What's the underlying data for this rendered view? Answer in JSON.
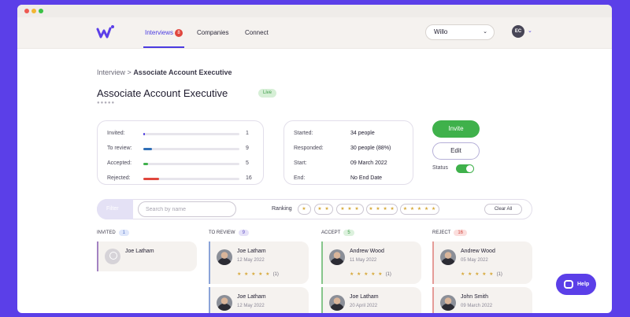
{
  "nav": {
    "links": [
      {
        "label": "Interviews",
        "badge": "8"
      },
      {
        "label": "Companies"
      },
      {
        "label": "Connect"
      }
    ],
    "company": "Willo",
    "user_initials": "EC"
  },
  "breadcrumb": {
    "parent": "Interview",
    "separator": ">",
    "current": "Associate Account Executive"
  },
  "job": {
    "title": "Associate Account Executive",
    "status": "Live",
    "subtitle": "●●●●●"
  },
  "stats": [
    {
      "label": "Invited:",
      "value": "1",
      "fraction": 0.02,
      "color": "#4b3be0"
    },
    {
      "label": "To review:",
      "value": "9",
      "fraction": 0.09,
      "color": "#2f6fb7"
    },
    {
      "label": "Accepted:",
      "value": "5",
      "fraction": 0.05,
      "color": "#3fb14b"
    },
    {
      "label": "Rejected:",
      "value": "16",
      "fraction": 0.16,
      "color": "#e0463d"
    }
  ],
  "info": [
    {
      "label": "Started:",
      "value": "34 people"
    },
    {
      "label": "Responded:",
      "value": "30 people (88%)"
    },
    {
      "label": "Start:",
      "value": "09 March 2022"
    },
    {
      "label": "End:",
      "value": "No End Date"
    }
  ],
  "actions": {
    "invite": "Invite",
    "edit": "Edit",
    "status_label": "Status",
    "status_on": true
  },
  "filter": {
    "label": "Filter",
    "search_placeholder": "Search by name",
    "ranking_label": "Ranking",
    "ranks": [
      "★",
      "★ ★",
      "★ ★ ★",
      "★ ★ ★ ★",
      "★ ★ ★ ★ ★"
    ],
    "clear": "Clear All"
  },
  "columns": [
    {
      "title": "INVITED",
      "count": "1",
      "cards": [
        {
          "name": "Joe Latham",
          "date": "",
          "rating": "",
          "rating_count": ""
        }
      ]
    },
    {
      "title": "TO REVIEW",
      "count": "9",
      "cards": [
        {
          "name": "Joe Latham",
          "date": "12 May 2022",
          "rating": "★ ★ ★ ★ ★",
          "rating_count": "(1)"
        },
        {
          "name": "Joe Latham",
          "date": "12 May 2022",
          "rating": "",
          "rating_count": ""
        }
      ]
    },
    {
      "title": "ACCEPT",
      "count": "5",
      "cards": [
        {
          "name": "Andrew Wood",
          "date": "11 May 2022",
          "rating": "★ ★ ★ ★ ★",
          "rating_count": "(1)"
        },
        {
          "name": "Joe Latham",
          "date": "20 April 2022",
          "rating": "",
          "rating_count": ""
        }
      ]
    },
    {
      "title": "REJECT",
      "count": "16",
      "cards": [
        {
          "name": "Andrew Wood",
          "date": "05 May 2022",
          "rating": "★ ★ ★ ★ ★",
          "rating_count": "(1)"
        },
        {
          "name": "John Smith",
          "date": "09 March 2022",
          "rating": "",
          "rating_count": ""
        }
      ]
    }
  ],
  "help": "Help"
}
